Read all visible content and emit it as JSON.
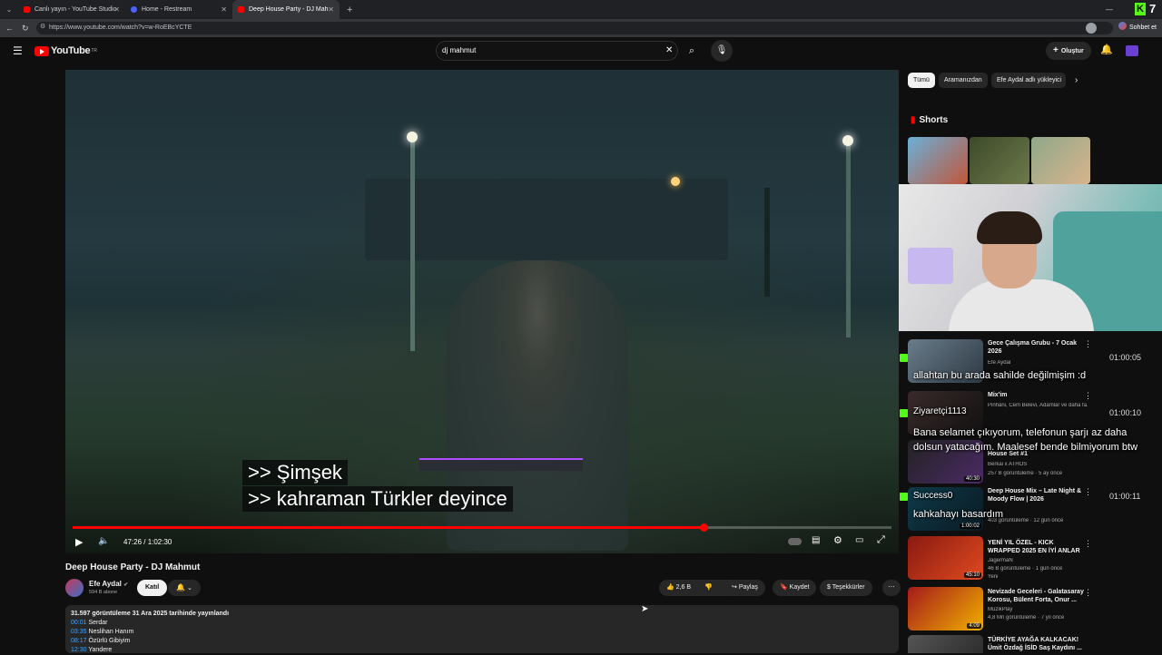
{
  "browser": {
    "tabs": [
      {
        "label": "Canlı yayın - YouTube Studio",
        "color": "#ff0000"
      },
      {
        "label": "Home - Restream",
        "color": "#4c62ff"
      },
      {
        "label": "Deep House Party - DJ Mahmut",
        "color": "#ff0000"
      }
    ],
    "url": "https://www.youtube.com/watch?v=w-RoEBcYCTE",
    "chat_label": "Sohbet et"
  },
  "youtube": {
    "logo": "YouTube",
    "country": "TR",
    "search_value": "dj mahmut",
    "create_label": "Oluştur"
  },
  "video": {
    "captions": [
      ">> Şimşek",
      ">> kahraman Türkler deyince"
    ],
    "time": "47:26 / 1:02:30",
    "progress": 0.77,
    "title": "Deep House Party - DJ Mahmut",
    "channel": "Efe Aydal",
    "subscribers": "594 B abone",
    "join_label": "Katıl",
    "likes": "2,6 B",
    "share_label": "Paylaş",
    "save_label": "Kaydet",
    "thanks_label": "Teşekkürler",
    "views_line": "31.597 görüntüleme  31 Ara 2025 tarihinde yayınlandı",
    "chapters": [
      {
        "time": "00:01",
        "name": "Serdar"
      },
      {
        "time": "03:35",
        "name": "Neslihan Hanım"
      },
      {
        "time": "08:17",
        "name": "Özürlü Gibiyim"
      },
      {
        "time": "12:30",
        "name": "Yandere"
      }
    ]
  },
  "sidebar": {
    "chips": [
      "Tümü",
      "Aramanızdan",
      "Efe Aydal adlı yükleyici"
    ],
    "shorts_label": "Shorts",
    "recommendations": [
      {
        "title": "Gece Çalışma Grubu - 7 Ocak 2026",
        "channel": "Efe Aydal",
        "meta": "",
        "duration": ""
      },
      {
        "title": "Mix'im",
        "channel": "Pinhâni, Cem Belevi, Adamlar ve daha fa...",
        "meta": "",
        "duration": ""
      },
      {
        "title": "House Set #1",
        "channel": "Berkai x ATHOS",
        "meta": "257 B görüntüleme · 5 ay önce",
        "duration": "40:30"
      },
      {
        "title": "Deep House Mix – Late Night & Moody Flow | 2026",
        "channel": "",
        "meta": "403 görüntüleme · 12 gün önce",
        "duration": "1:00:02"
      },
      {
        "title": "YENİ YIL ÖZEL - KICK WRAPPED 2025 EN İYİ ANLAR",
        "channel": "JagermaN",
        "meta": "46 B görüntüleme · 1 gün önce",
        "duration": "45:10"
      },
      {
        "title": "Nevizade Geceleri - Galatasaray Korosu, Bülent Forta, Onur ...",
        "channel": "MüzikPlay",
        "meta": "4,8 Mn görüntüleme · 7 yıl önce",
        "duration": "4:09"
      },
      {
        "title": "TÜRKİYE AYAĞA KALKACAK! Ümit Özdağ İSİD Saş Kaydını ...",
        "channel": "",
        "meta": "",
        "duration": ""
      }
    ],
    "new_badge": "Yeni"
  },
  "chat_overlay": {
    "messages": [
      {
        "text": "allahtan bu arada sahilde değilmişim :d",
        "time": "01:00:05"
      },
      {
        "user": "Ziyaretçi1113",
        "text": "Bana selamet çıkıyorum, telefonun şarjı az daha dolsun yatacağım. Maalesef bende bilmiyorum btw",
        "time": "01:00:10"
      },
      {
        "user": "Success0",
        "text": "kahkahayı basardım",
        "time": "01:00:11"
      }
    ],
    "kick_icon": "K"
  },
  "colors": {
    "accent": "#ff0000",
    "kick": "#53fc18",
    "link": "#3ea6ff"
  }
}
